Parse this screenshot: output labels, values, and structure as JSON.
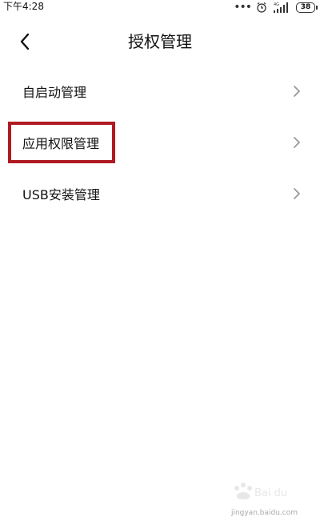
{
  "status_bar": {
    "time": "下午4:28",
    "icons": [
      "more-dots-icon",
      "alarm-icon",
      "signal-4g-icon"
    ],
    "battery": "38"
  },
  "header": {
    "title": "授权管理",
    "back_icon": "chevron-left-icon"
  },
  "menu": {
    "items": [
      {
        "label": "自启动管理",
        "icon": "chevron-right-icon"
      },
      {
        "label": "应用权限管理",
        "icon": "chevron-right-icon",
        "highlighted": true
      },
      {
        "label": "USB安装管理",
        "icon": "chevron-right-icon"
      }
    ]
  },
  "colors": {
    "highlight": "#b01a22",
    "text": "#111111",
    "chevron": "#999999",
    "background": "#ffffff"
  },
  "watermark": {
    "text": "jingyan.baidu.com"
  }
}
